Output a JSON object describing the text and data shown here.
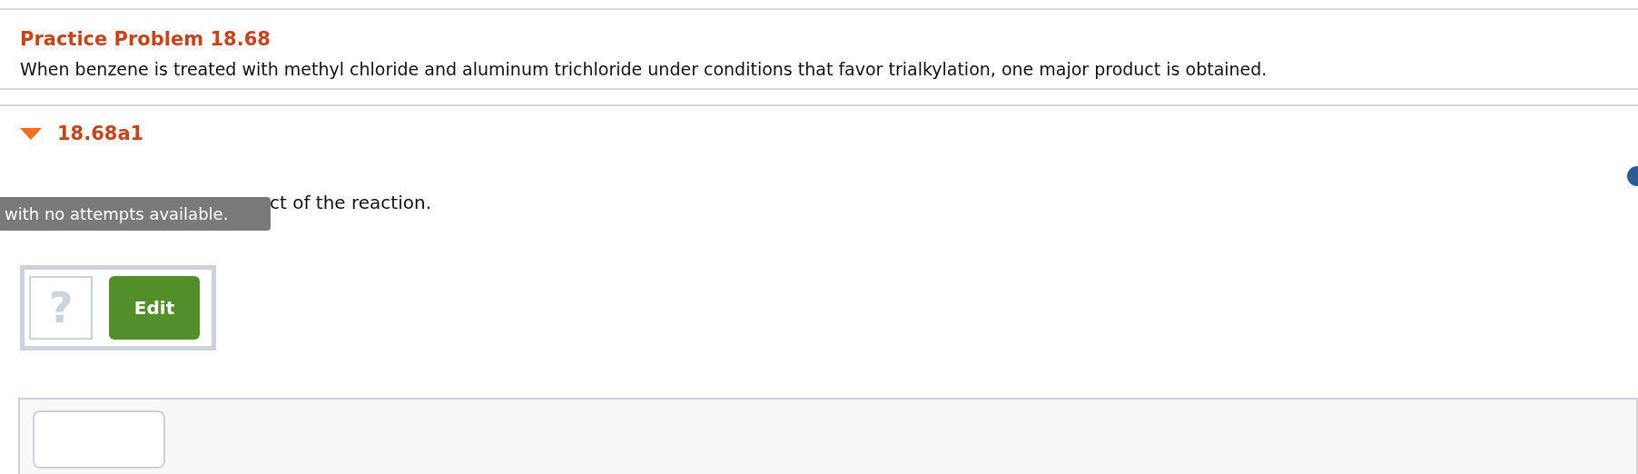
{
  "problem": {
    "title": "Practice Problem 18.68",
    "text": "When benzene is treated with methyl chloride and aluminum trichloride under conditions that favor trialkylation, one major product is obtained."
  },
  "part": {
    "label": "18.68a1",
    "expanded": true,
    "instruction": "ct of the reaction.",
    "tooltip": "with no attempts available.",
    "answer": {
      "placeholder": "?",
      "button": "Edit"
    }
  }
}
